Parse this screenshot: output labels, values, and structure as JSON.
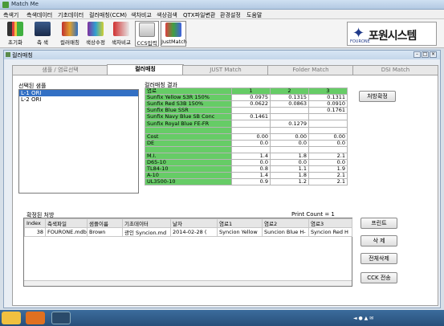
{
  "window": {
    "title": "Match Me"
  },
  "menu": [
    "측색기",
    "측색데이터",
    "기초데이터",
    "컬러매칭(CCM)",
    "색차비교",
    "색상검색",
    "QTX파일변환",
    "환경설정",
    "도움말"
  ],
  "toolbar": {
    "buttons": [
      {
        "label": "초기화",
        "icon": "traffic-light-icon"
      },
      {
        "label": "측 색",
        "icon": "measure-icon"
      },
      {
        "label": "컬러매칭",
        "icon": "color-matching-icon"
      },
      {
        "label": "색상수정",
        "icon": "color-correction-icon"
      },
      {
        "label": "색차비교",
        "icon": "color-diff-icon"
      },
      {
        "label": "CCS입력",
        "icon": "ccs-input-icon"
      },
      {
        "label": "JustMatch",
        "icon": "justmatch-icon"
      }
    ]
  },
  "logo": {
    "brand": "포원시스템",
    "sub": "FOURONE"
  },
  "child": {
    "title": "컬러매칭"
  },
  "tabs": [
    "샘플 / 염료선택",
    "컬러매칭",
    "JUST Match",
    "Folder Match",
    "DSI Match"
  ],
  "active_tab": 1,
  "sample_list": {
    "label": "선택된 샘플",
    "items": [
      "L-1 ORI",
      "L-2 ORI"
    ],
    "selected": 0
  },
  "results": {
    "label": "컬러매칭 결과",
    "headers": [
      "염료",
      "1",
      "2",
      "3"
    ],
    "rows": [
      [
        "Sunfix Yellow S3R 150%",
        "0.0975",
        "0.1315",
        "0.1311"
      ],
      [
        "Sunfix Red S3B 150%",
        "0.0622",
        "0.0863",
        "0.0910"
      ],
      [
        "Sunfix Blue SSR",
        "",
        "",
        "0.1761"
      ],
      [
        "Sunfix Navy Blue SB Conc",
        "0.1461",
        "",
        ""
      ],
      [
        "Sunfix Royal Blue FE-FR",
        "",
        "0.1279",
        ""
      ],
      [
        "",
        "",
        "",
        ""
      ],
      [
        "Cost",
        "0.00",
        "0.00",
        "0.00"
      ],
      [
        "DE",
        "0.0",
        "0.0",
        "0.0"
      ],
      [
        "",
        "",
        "",
        ""
      ],
      [
        "M.I.",
        "1.4",
        "1.8",
        "2.1"
      ],
      [
        "D65-10",
        "0.0",
        "0.0",
        "0.0"
      ],
      [
        "TL84-10",
        "0.8",
        "1.1",
        "1.9"
      ],
      [
        "A-10",
        "1.4",
        "1.8",
        "2.1"
      ],
      [
        "UL3500-10",
        "0.9",
        "1.2",
        "2.1"
      ]
    ]
  },
  "buttons": {
    "confirm": "처방확정",
    "print": "프린트",
    "delete": "삭 제",
    "delete_all": "전체삭제",
    "ccs_send": "CCK 전송"
  },
  "recipe": {
    "label": "확정된 처방",
    "print_count": "Print Count = 1",
    "headers": [
      "Index",
      "측색파일",
      "샘플이름",
      "기초데이터",
      "날자",
      "염료1",
      "염료2",
      "염료3"
    ],
    "rows": [
      [
        "38",
        "FOURONE.mdb",
        "Brown",
        "광인 Syncion.md",
        "2014-02-28 (",
        "Syncion Yellow",
        "Suncion Blue H-",
        "Syncion Red H"
      ]
    ]
  }
}
